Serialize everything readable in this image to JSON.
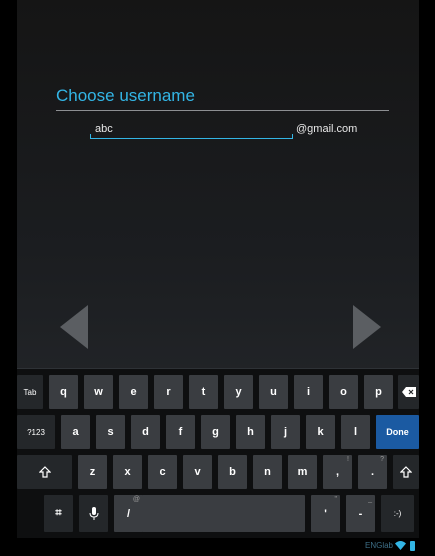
{
  "form": {
    "title": "Choose username",
    "username_value": "abc",
    "domain_suffix": "@gmail.com"
  },
  "navigation": {
    "back_icon": "triangle-left-icon",
    "next_icon": "triangle-right-icon"
  },
  "keyboard": {
    "row1": [
      "Tab",
      "q",
      "w",
      "e",
      "r",
      "t",
      "y",
      "u",
      "i",
      "o",
      "p"
    ],
    "row2": [
      "?123",
      "a",
      "s",
      "d",
      "f",
      "g",
      "h",
      "j",
      "k",
      "l",
      "Done"
    ],
    "row3": [
      "z",
      "x",
      "c",
      "v",
      "b",
      "n",
      "m",
      ",",
      "."
    ],
    "row3_alts": [
      "!",
      "?"
    ],
    "row4_slash": "/",
    "row4_slash_alt": "@",
    "row4_apostrophe": "'",
    "row4_apostrophe_alt": "\"",
    "row4_dash": "-",
    "row4_dash_alt": "_",
    "row4_smiley": ":-)",
    "row4_settings_glyph": "⌗"
  },
  "status_bar": {
    "carrier": "ENGlab"
  },
  "colors": {
    "accent": "#33b5e5",
    "key_bg": "#3a3d41",
    "done_bg": "#1b5aa2"
  }
}
